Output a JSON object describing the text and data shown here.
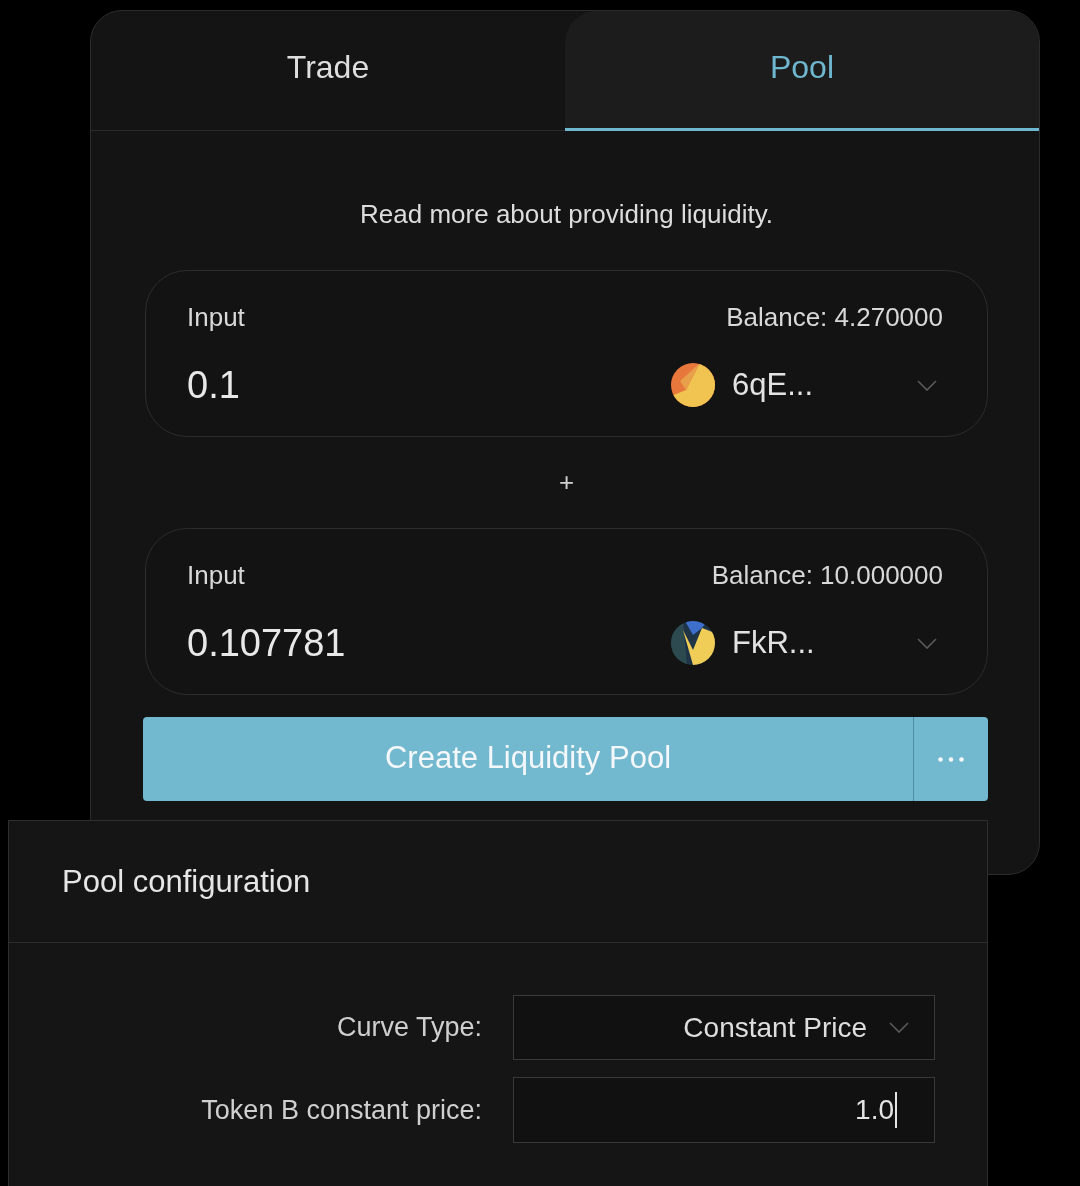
{
  "tabs": [
    {
      "label": "Trade",
      "selected": false
    },
    {
      "label": "Pool",
      "selected": true
    }
  ],
  "info_link": "Read more about providing liquidity.",
  "inputs": [
    {
      "label": "Input",
      "balance": "Balance: 4.270000",
      "value": "0.1",
      "token": "6qE..."
    },
    {
      "label": "Input",
      "balance": "Balance: 10.000000",
      "value": "0.107781",
      "token": "FkR..."
    }
  ],
  "separator": "+",
  "create_button": "Create Liquidity Pool",
  "pool_configuration": {
    "title": "Pool configuration",
    "fields": [
      {
        "kind": "select",
        "label": "Curve Type:",
        "value": "Constant Price"
      },
      {
        "kind": "input",
        "label": "Token B constant price:",
        "value": "1.0",
        "focused": true
      }
    ]
  }
}
